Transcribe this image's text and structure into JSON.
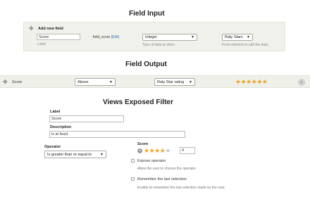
{
  "field_input": {
    "title": "Field Input",
    "add_label": "Add new field",
    "label_value": "Score",
    "label_caption": "Label",
    "machine_name": "field_score",
    "edit_link": "[Edit]",
    "type_value": "Integer",
    "type_caption": "Type of data to store.",
    "widget_value": "Raty Stars",
    "widget_caption": "Form element to edit the data."
  },
  "field_output": {
    "title": "Field Output",
    "field_label": "Score",
    "label_position": "Above",
    "formatter": "Raty Star rating",
    "stars_filled": 6,
    "stars_total": 6
  },
  "exposed_filter": {
    "title": "Views Exposed Filter",
    "label_caption": "Label",
    "label_value": "Score",
    "description_caption": "Description",
    "description_value": "is at least",
    "operator_caption": "Operator",
    "operator_value": "Is greater than or equal to",
    "score_caption": "Score",
    "score_value": "4",
    "stars_filled": 4,
    "stars_total": 5,
    "expose_operator_label": "Expose operator",
    "expose_operator_desc": "Allow the user to choose the operator.",
    "remember_label": "Remember the last selection",
    "remember_desc": "Enable to remember the last selection made by the user."
  },
  "colors": {
    "star": "#f0a321",
    "panel_bg": "#f1f1ec",
    "link": "#2a6ebb"
  }
}
